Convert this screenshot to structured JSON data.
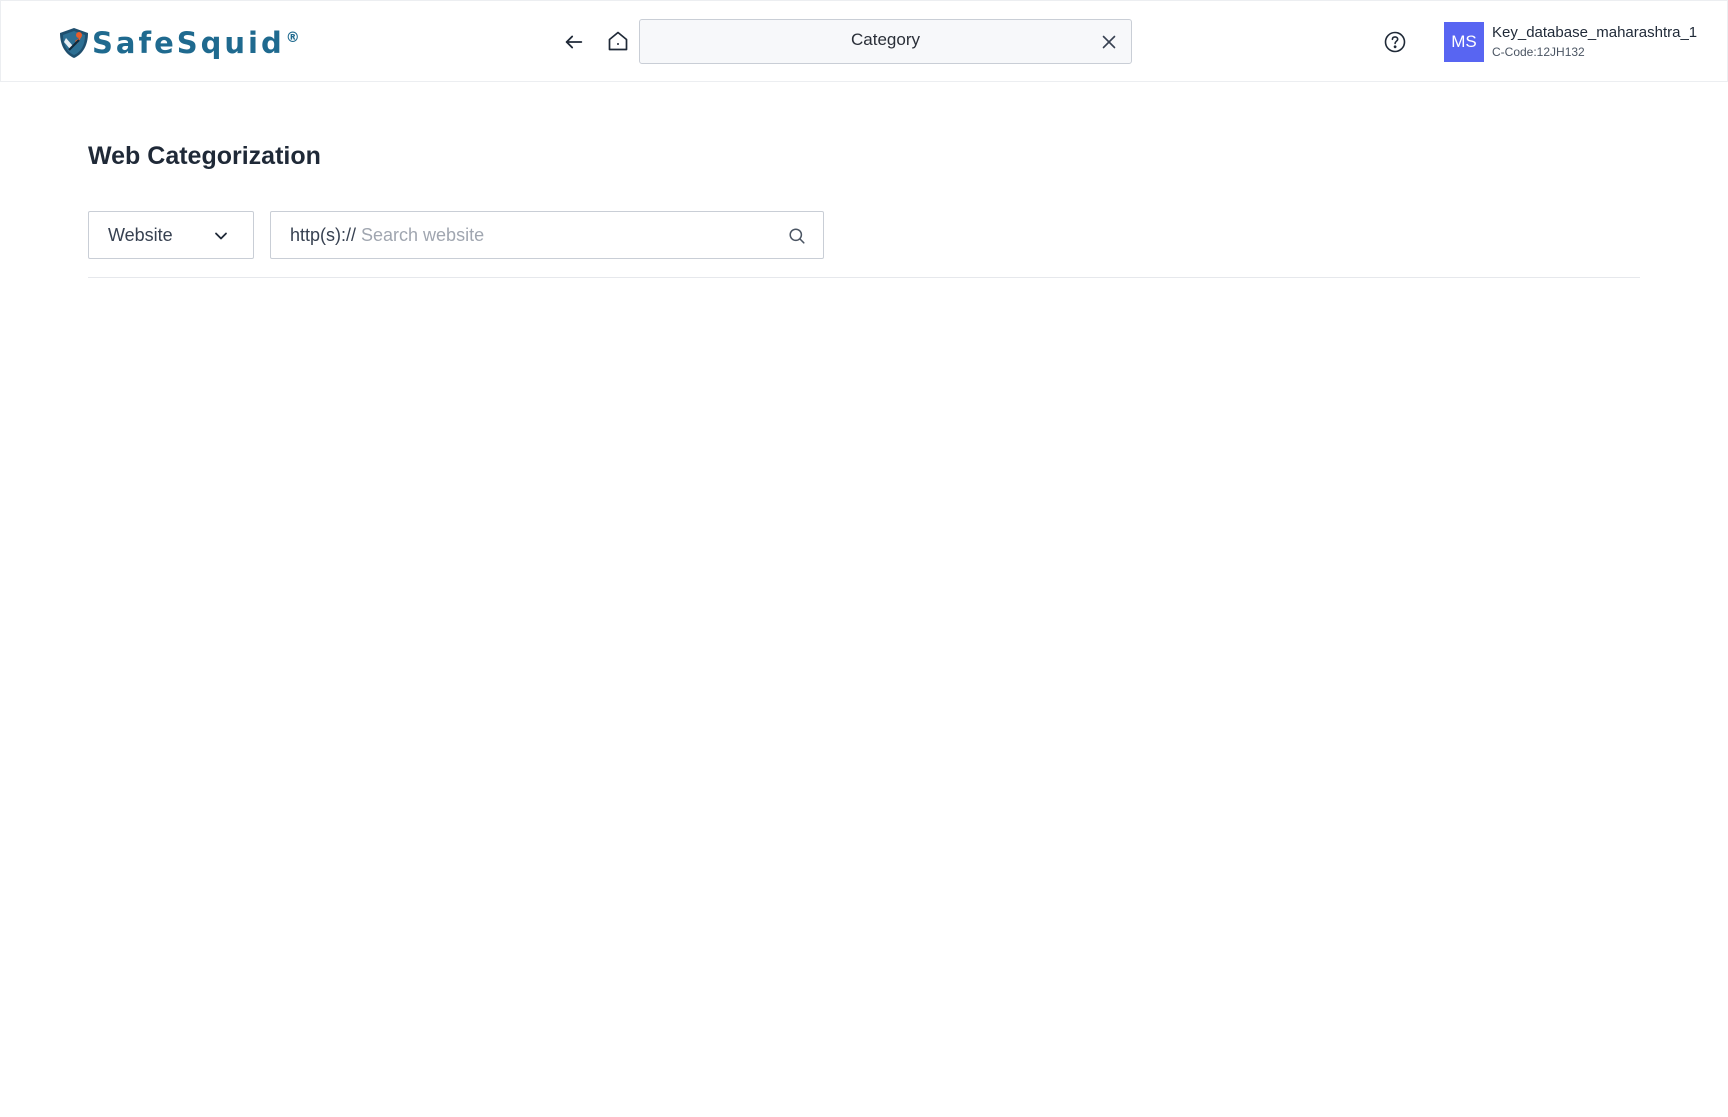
{
  "header": {
    "logo_text": "SafeSquid",
    "logo_mark": "®",
    "current_page": "Category",
    "user": {
      "initials": "MS",
      "name": "Key_database_maharashtra_1",
      "code": "C-Code:12JH132"
    },
    "icons": {
      "back": "arrow-left-icon",
      "home": "home-icon",
      "close": "close-icon",
      "help": "question-circle-icon"
    }
  },
  "main": {
    "title": "Web Categorization",
    "type_select": {
      "selected": "Website"
    },
    "search": {
      "prefix": "http(s)://",
      "value": "",
      "placeholder": "Search website"
    }
  },
  "colors": {
    "brand": "#1f6a8f",
    "avatar_bg": "#5865f2",
    "border": "#c9ced6"
  }
}
